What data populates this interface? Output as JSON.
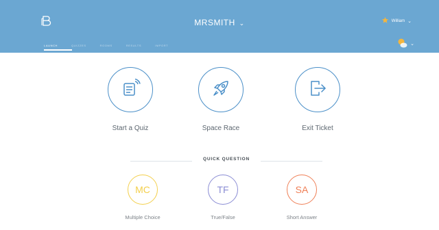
{
  "header": {
    "room_name": "MRSMITH",
    "room_caret": "⌄",
    "user_name": "William",
    "user_caret": "⌄",
    "notif_caret": "⌄",
    "tabs": [
      {
        "label": "LAUNCH"
      },
      {
        "label": "QUIZZES"
      },
      {
        "label": "ROOMS"
      },
      {
        "label": "RESULTS"
      },
      {
        "label": "IMPORT"
      }
    ]
  },
  "activities": [
    {
      "label": "Start a Quiz",
      "icon": "quiz-icon"
    },
    {
      "label": "Space Race",
      "icon": "rocket-icon"
    },
    {
      "label": "Exit Ticket",
      "icon": "exit-icon"
    }
  ],
  "quick_question": {
    "title": "QUICK QUESTION",
    "items": [
      {
        "abbr": "MC",
        "label": "Multiple Choice",
        "color": "#f3cf4b"
      },
      {
        "abbr": "TF",
        "label": "True/False",
        "color": "#8a8cd4"
      },
      {
        "abbr": "SA",
        "label": "Short Answer",
        "color": "#ef7f56"
      }
    ]
  },
  "colors": {
    "header_bg": "#6ba7d2",
    "accent_blue": "#4a8fc8",
    "star": "#f4b63f"
  }
}
